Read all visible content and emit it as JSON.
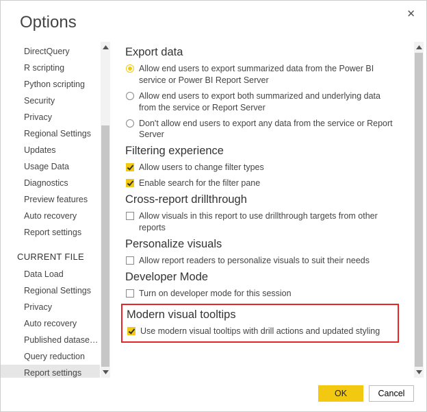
{
  "title": "Options",
  "sidebar": {
    "header_current_file": "CURRENT FILE",
    "global_items": [
      {
        "label": "DirectQuery"
      },
      {
        "label": "R scripting"
      },
      {
        "label": "Python scripting"
      },
      {
        "label": "Security"
      },
      {
        "label": "Privacy"
      },
      {
        "label": "Regional Settings"
      },
      {
        "label": "Updates"
      },
      {
        "label": "Usage Data"
      },
      {
        "label": "Diagnostics"
      },
      {
        "label": "Preview features"
      },
      {
        "label": "Auto recovery"
      },
      {
        "label": "Report settings"
      }
    ],
    "file_items": [
      {
        "label": "Data Load"
      },
      {
        "label": "Regional Settings"
      },
      {
        "label": "Privacy"
      },
      {
        "label": "Auto recovery"
      },
      {
        "label": "Published dataset set..."
      },
      {
        "label": "Query reduction"
      },
      {
        "label": "Report settings",
        "selected": true
      }
    ]
  },
  "main": {
    "groups": {
      "export_data": {
        "title": "Export data",
        "opts": [
          "Allow end users to export summarized data from the Power BI service or Power BI Report Server",
          "Allow end users to export both summarized and underlying data from the service or Report Server",
          "Don't allow end users to export any data from the service or Report Server"
        ]
      },
      "filtering": {
        "title": "Filtering experience",
        "opts": [
          "Allow users to change filter types",
          "Enable search for the filter pane"
        ]
      },
      "cross_report": {
        "title": "Cross-report drillthrough",
        "opts": [
          "Allow visuals in this report to use drillthrough targets from other reports"
        ]
      },
      "personalize": {
        "title": "Personalize visuals",
        "opts": [
          "Allow report readers to personalize visuals to suit their needs"
        ]
      },
      "developer": {
        "title": "Developer Mode",
        "opts": [
          "Turn on developer mode for this session"
        ]
      },
      "tooltips": {
        "title": "Modern visual tooltips",
        "opts": [
          "Use modern visual tooltips with drill actions and updated styling"
        ]
      }
    }
  },
  "footer": {
    "ok": "OK",
    "cancel": "Cancel"
  }
}
